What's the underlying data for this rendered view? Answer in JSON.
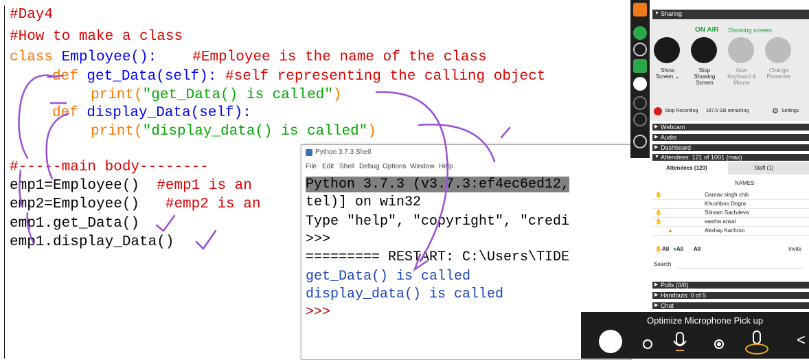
{
  "editor": {
    "lines": {
      "l1": "#Day4",
      "l2": "#How to make a class",
      "l3_kw": "class",
      "l3_name": " Employee():",
      "l3_comment": "#Employee is the name of the class",
      "l4_kw": "def",
      "l4_name": " get_Data(self):",
      "l4_comment": " #self representing the calling object",
      "l5_kw": "print(",
      "l5_str": "\"get_Data() is called\"",
      "l5_end": ")",
      "l6_kw": "def",
      "l6_name": " display_Data(self):",
      "l7_kw": "print(",
      "l7_str": "\"display_data() is called\"",
      "l7_end": ")",
      "l8": "#-----main body--------",
      "l9_code": "emp1=Employee()",
      "l9_comment": "  #emp1 is an",
      "l10_code": "emp2=Employee()",
      "l10_comment": "   #emp2 is an",
      "l11": "emp1.get_Data()",
      "l12": "emp1.display_Data()"
    }
  },
  "shell": {
    "title": "Python 3.7.3 Shell",
    "menu": [
      "File",
      "Edit",
      "Shell",
      "Debug",
      "Options",
      "Window",
      "Help"
    ],
    "line1": "Python 3.7.3 (v3.7.3:ef4ec6ed12,",
    "line2": "tel)] on win32",
    "line3": "Type \"help\", \"copyright\", \"credi",
    "line4": ">>>",
    "line5": "========= RESTART: C:\\Users\\TIDE",
    "line6": "get_Data() is called",
    "line7": "display_data() is called",
    "line8": ">>>"
  },
  "panel": {
    "sharing_title": "Sharing",
    "on_air": "ON AIR",
    "showing_screen": "Showing screen",
    "btn_show_l1": "Show",
    "btn_show_l2": "Screen",
    "btn_stop_l1": "Stop",
    "btn_stop_l2": "Showing",
    "btn_stop_l3": "Screen",
    "btn_give_l1": "Give",
    "btn_give_l2": "Keyboard &",
    "btn_give_l3": "Mouse",
    "btn_change_l1": "Change",
    "btn_change_l2": "Presenter",
    "stop_recording": "Stop Recording",
    "remaining": "187.6 GB remaining",
    "settings": "Settings",
    "webcam": "Webcam",
    "audio": "Audio",
    "dashboard": "Dashboard",
    "attendees_header": "Attendees: 121 of 1001 (max)",
    "tab_attendees": "Attendees (120)",
    "tab_staff": "Staff (1)",
    "col_names": "NAMES",
    "attendees": [
      "Gaurav singh chib",
      "Khushboo Dogra",
      "Shivam Sachdeva",
      "aastha ansal",
      "Akshay Kachroo"
    ],
    "all1": "All",
    "all2": "All",
    "all3": "All",
    "invite": "Invite",
    "search_label": "Search",
    "polls": "Polls (0/0)",
    "handouts": "Handouts: 0 of 5",
    "chat": "Chat"
  },
  "mic": {
    "title": "Optimize Microphone Pick up"
  },
  "colors": {
    "comment": "#dd0000",
    "keyword": "#ff7700",
    "def_name": "#0000ff",
    "string": "#00aa00",
    "ink": "#9b4fd6",
    "on_air": "#1f9e3a"
  }
}
